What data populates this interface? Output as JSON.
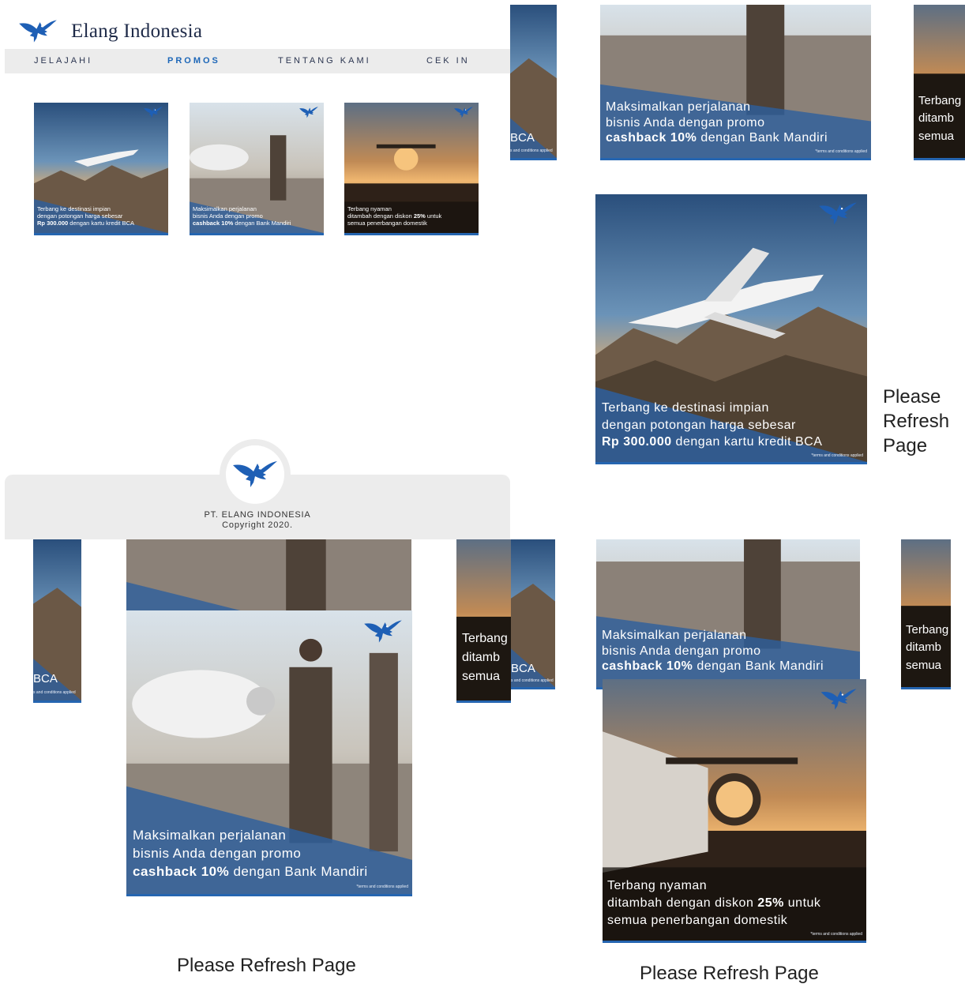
{
  "brand": {
    "name": "Elang Indonesia",
    "logo_icon": "eagle-icon"
  },
  "nav": {
    "items": [
      {
        "label": "JELAJAHI",
        "active": false
      },
      {
        "label": "PROMOS",
        "active": true
      },
      {
        "label": "TENTANG KAMI",
        "active": false
      },
      {
        "label": "CEK IN",
        "active": false
      }
    ]
  },
  "promos": {
    "bca": {
      "line1": "Terbang ke destinasi impian",
      "line2": "dengan potongan harga sebesar",
      "bold": "Rp 300.000",
      "rest": " dengan kartu kredit BCA"
    },
    "mandiri": {
      "line1": "Maksimalkan perjalanan",
      "line2": "bisnis Anda dengan promo",
      "bold": "cashback 10%",
      "rest": " dengan Bank Mandiri"
    },
    "domestic": {
      "line1": "Terbang nyaman",
      "line2a": "ditambah dengan diskon ",
      "line2b": "25%",
      "line2c": " untuk",
      "line3": "semua penerbangan domestik"
    },
    "terms": "*terms and conditions applied",
    "fragments": {
      "bca": "BCA",
      "terbang": "Terbang",
      "ditamb": "ditamb",
      "semua": "semua",
      "terms_short": "s and conditions applied"
    }
  },
  "footer": {
    "company": "PT. ELANG INDONESIA",
    "copyright": "Copyright 2020."
  },
  "status": {
    "refresh": "Please Refresh Page",
    "refresh_lines": [
      "Please",
      "Refresh",
      "Page"
    ]
  },
  "colors": {
    "accent": "#1d67b8",
    "nav_bg": "#ececec",
    "card_border": "#2565b0"
  }
}
